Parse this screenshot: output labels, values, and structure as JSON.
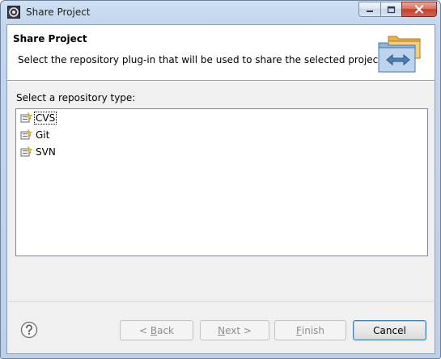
{
  "window": {
    "title": "Share Project",
    "controls": {
      "minimize_icon": "minimize-icon",
      "maximize_icon": "maximize-icon",
      "close_icon": "close-icon"
    }
  },
  "header": {
    "title": "Share Project",
    "description": "Select the repository plug-in that will be used to share the selected project.",
    "image": "share-folders-icon"
  },
  "repository": {
    "label": "Select a repository type:",
    "items": [
      {
        "label": "CVS",
        "icon": "cvs-repository-icon",
        "selected": true
      },
      {
        "label": "Git",
        "icon": "git-repository-icon",
        "selected": false
      },
      {
        "label": "SVN",
        "icon": "svn-repository-icon",
        "selected": false
      }
    ]
  },
  "buttons": {
    "back": {
      "pre": "< ",
      "mnemonic": "B",
      "post": "ack",
      "enabled": false
    },
    "next": {
      "pre": "",
      "mnemonic": "N",
      "post": "ext >",
      "enabled": false
    },
    "finish": {
      "pre": "",
      "mnemonic": "F",
      "post": "inish",
      "enabled": false
    },
    "cancel": {
      "label": "Cancel",
      "enabled": true
    }
  },
  "colors": {
    "accent_blue": "#3c7fb1",
    "close_red": "#c2402b",
    "disabled_text": "#8d8d8d"
  }
}
